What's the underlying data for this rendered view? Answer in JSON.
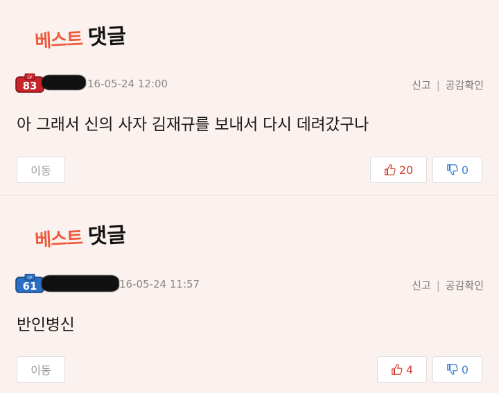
{
  "comments": [
    {
      "best_label_1": "베스트",
      "best_label_2": "댓글",
      "level": "83",
      "level_color": "#c8242b",
      "date": "16-05-24 12:00",
      "report": "신고",
      "sympathy": "공감확인",
      "text": "아 그래서 신의 사자 김재규를 보내서 다시 데려갔구나",
      "move": "이동",
      "upvotes": "20",
      "downvotes": "0"
    },
    {
      "best_label_1": "베스트",
      "best_label_2": "댓글",
      "level": "61",
      "level_color": "#2a6fc4",
      "date": "16-05-24 11:57",
      "report": "신고",
      "sympathy": "공감확인",
      "text": "반인병신",
      "move": "이동",
      "upvotes": "4",
      "downvotes": "0"
    }
  ],
  "icons": {
    "lv_label": "LV",
    "thumbs_up": "thumbs-up-icon",
    "thumbs_down": "thumbs-down-icon"
  }
}
